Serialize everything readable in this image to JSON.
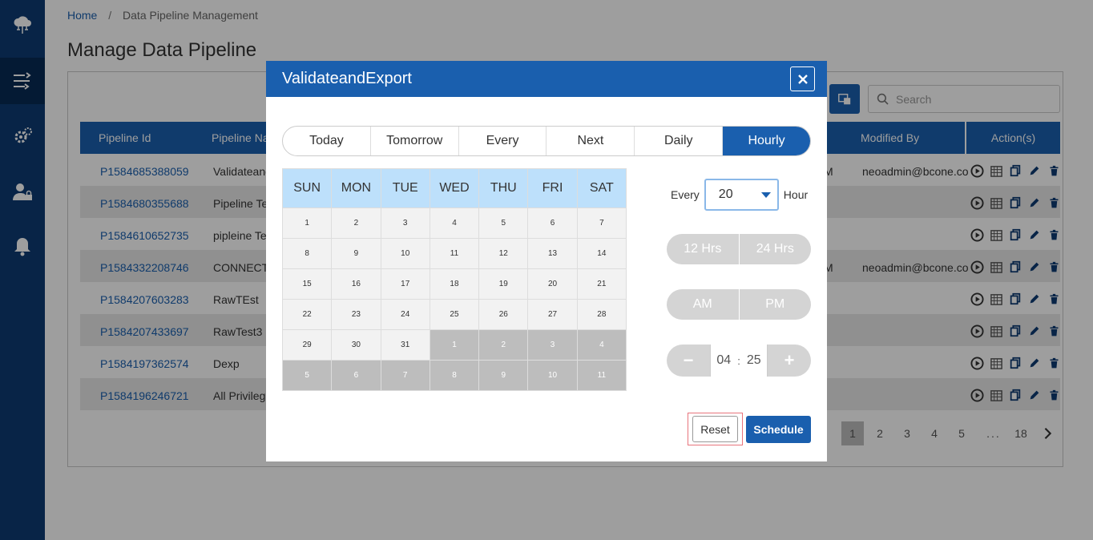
{
  "breadcrumb": {
    "home": "Home",
    "separator": "/",
    "current": "Data Pipeline Management"
  },
  "page_title": "Manage Data Pipeline",
  "search": {
    "placeholder": "Search"
  },
  "table": {
    "headers": {
      "pipeline_id": "Pipeline Id",
      "pipeline_name": "Pipeline Na",
      "modified_by": "Modified By",
      "actions": "Action(s)"
    },
    "rows": [
      {
        "id": "P1584685388059",
        "name": "Validateand",
        "mtime": "M",
        "mby": "neoadmin@bcone.co"
      },
      {
        "id": "P1584680355688",
        "name": "Pipeline Te",
        "mtime": "",
        "mby": ""
      },
      {
        "id": "P1584610652735",
        "name": "pipleine Te",
        "mtime": "",
        "mby": ""
      },
      {
        "id": "P1584332208746",
        "name": "CONNECTI",
        "mtime": "M",
        "mby": "neoadmin@bcone.co"
      },
      {
        "id": "P1584207603283",
        "name": "RawTEst",
        "mtime": "",
        "mby": ""
      },
      {
        "id": "P1584207433697",
        "name": "RawTest3",
        "mtime": "",
        "mby": ""
      },
      {
        "id": "P1584197362574",
        "name": "Dexp",
        "mtime": "",
        "mby": ""
      },
      {
        "id": "P1584196246721",
        "name": "All Privilege",
        "mtime": "",
        "mby": ""
      }
    ]
  },
  "pager": {
    "pages": [
      "1",
      "2",
      "3",
      "4",
      "5"
    ],
    "dots": "...",
    "last": "18",
    "active": "1"
  },
  "modal": {
    "title": "ValidateandExport",
    "tabs": [
      "Today",
      "Tomorrow",
      "Every",
      "Next",
      "Daily",
      "Hourly"
    ],
    "active_tab": "Hourly",
    "calendar": {
      "days": [
        "SUN",
        "MON",
        "TUE",
        "WED",
        "THU",
        "FRI",
        "SAT"
      ],
      "weeks": [
        [
          "1",
          "2",
          "3",
          "4",
          "5",
          "6",
          "7"
        ],
        [
          "8",
          "9",
          "10",
          "11",
          "12",
          "13",
          "14"
        ],
        [
          "15",
          "16",
          "17",
          "18",
          "19",
          "20",
          "21"
        ],
        [
          "22",
          "23",
          "24",
          "25",
          "26",
          "27",
          "28"
        ],
        [
          "29",
          "30",
          "31",
          "1",
          "2",
          "3",
          "4"
        ],
        [
          "5",
          "6",
          "7",
          "8",
          "9",
          "10",
          "11"
        ]
      ],
      "current_month_cells": 31
    },
    "every_label": "Every",
    "every_value": "20",
    "hour_label": "Hour",
    "format_options": [
      "12 Hrs",
      "24 Hrs"
    ],
    "ampm_options": [
      "AM",
      "PM"
    ],
    "time": {
      "hour": "04",
      "sep": ":",
      "minute": "25",
      "minus": "−",
      "plus": "+"
    },
    "reset_label": "Reset",
    "schedule_label": "Schedule"
  },
  "colors": {
    "primary": "#1a5fae",
    "sidebar": "#0d3b73",
    "calendar_header": "#bde0fb"
  }
}
